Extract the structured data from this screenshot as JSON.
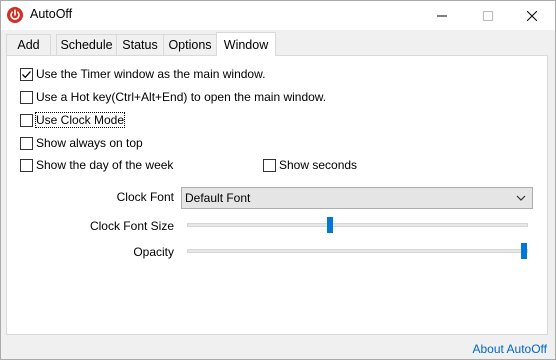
{
  "window": {
    "title": "AutoOff",
    "icon": "power-icon",
    "controls": [
      "minimize-icon",
      "maximize-icon",
      "close-icon"
    ]
  },
  "tabs": [
    {
      "label": "Add",
      "active": false
    },
    {
      "label": "Schedule",
      "active": false
    },
    {
      "label": "Status",
      "active": false
    },
    {
      "label": "Options",
      "active": false
    },
    {
      "label": "Window",
      "active": true
    }
  ],
  "options": {
    "timer_main": {
      "label": "Use the Timer window as the main window.",
      "checked": true
    },
    "hotkey": {
      "label": "Use a Hot key(Ctrl+Alt+End) to open the main window.",
      "checked": false
    },
    "clock_mode": {
      "label": "Use Clock Mode",
      "checked": false
    },
    "always_on_top": {
      "label": "Show always on top",
      "checked": false
    },
    "day_of_week": {
      "label": "Show the day of the week",
      "checked": false
    },
    "show_seconds": {
      "label": "Show seconds",
      "checked": false
    }
  },
  "clock_font": {
    "label": "Clock Font",
    "value": "Default Font"
  },
  "clock_font_size": {
    "label": "Clock Font Size",
    "level": 0.42
  },
  "opacity": {
    "label": "Opacity",
    "level": 1.0
  },
  "footer": {
    "about_link": "About AutoOff"
  },
  "colors": {
    "accent": "#0078d7",
    "link": "#0066cc",
    "app_icon": "#d03028"
  }
}
